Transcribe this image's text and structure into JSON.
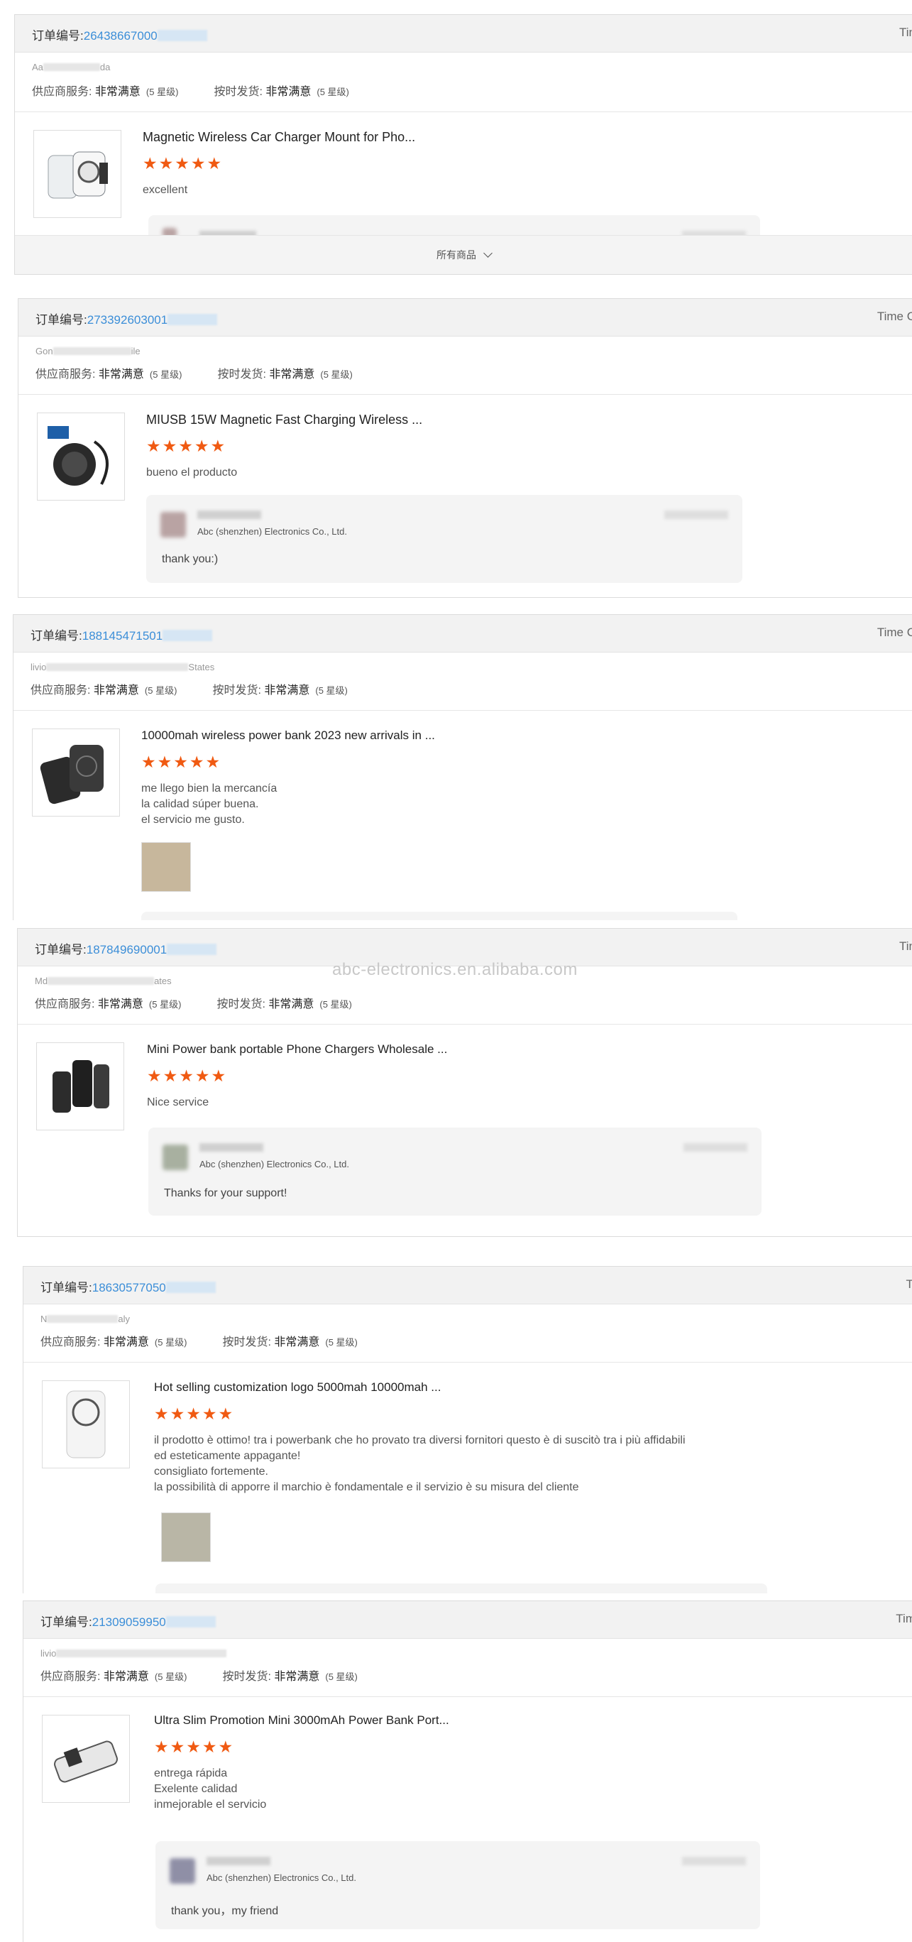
{
  "colors": {
    "accent": "#3b8ed8",
    "star": "#f05a12",
    "header_bg": "#f2f2f2",
    "reply_bg": "#f4f4f4"
  },
  "watermark": "abc-electronics.en.alibaba.com",
  "stars": "★★★★★",
  "ratings": {
    "supplier_label": "供应商服务:",
    "supplier_value": "非常满意",
    "supplier_level": "(5 星级)",
    "shipping_label": "按时发货:",
    "shipping_value": "非常满意",
    "shipping_level": "(5 星级)"
  },
  "order_label": "订单编号:",
  "reviews": [
    {
      "order_no": "26438667000",
      "time_label": "Tin",
      "buyer": "Aa",
      "buyer_end": "da",
      "product": "Magnetic Wireless Car Charger Mount for Pho...",
      "comment": [
        "excellent"
      ],
      "footer": "所有商品",
      "footer_icon": "chevron-down-icon"
    },
    {
      "order_no": "273392603001",
      "time_label": "Time C",
      "buyer": "Gon",
      "buyer_end": "ile",
      "product": "MIUSB 15W Magnetic Fast Charging Wireless ...",
      "comment": [
        "bueno el producto"
      ],
      "reply_company": "Abc (shenzhen) Electronics Co., Ltd.",
      "reply_text": "thank you:)"
    },
    {
      "order_no": "188145471501",
      "time_label": "Time C",
      "buyer": "livio",
      "buyer_end": "States",
      "product": "10000mah wireless power bank 2023 new arrivals in ...",
      "comment": [
        "me llego bien la mercancía",
        "la calidad súper buena.",
        "el servicio me gusto."
      ]
    },
    {
      "order_no": "187849690001",
      "time_label": "Tin",
      "buyer": "Md",
      "buyer_end": "ates",
      "product": "Mini Power bank portable Phone Chargers Wholesale ...",
      "comment": [
        "Nice service"
      ],
      "reply_company": "Abc (shenzhen) Electronics Co., Ltd.",
      "reply_text": "Thanks for your support!"
    },
    {
      "order_no": "18630577050",
      "time_label": "Ti",
      "buyer": "N",
      "buyer_end": "aly",
      "product": "Hot selling customization logo 5000mah 10000mah ...",
      "comment": [
        "il prodotto è ottimo! tra i powerbank che ho provato tra diversi fornitori questo è di suscitò tra i più affidabili",
        "ed esteticamente appagante!",
        "consigliato fortemente.",
        "la possibilità di apporre il marchio è fondamentale e il servizio è su misura del cliente"
      ]
    },
    {
      "order_no": "21309059950",
      "time_label": "Tim",
      "buyer": "livio",
      "buyer_end": "",
      "product": "Ultra Slim Promotion Mini 3000mAh Power Bank Port...",
      "comment": [
        "entrega rápida",
        "Exelente calidad",
        "inmejorable el servicio"
      ],
      "reply_company": "Abc (shenzhen) Electronics Co., Ltd.",
      "reply_text": "thank you，my friend"
    }
  ]
}
